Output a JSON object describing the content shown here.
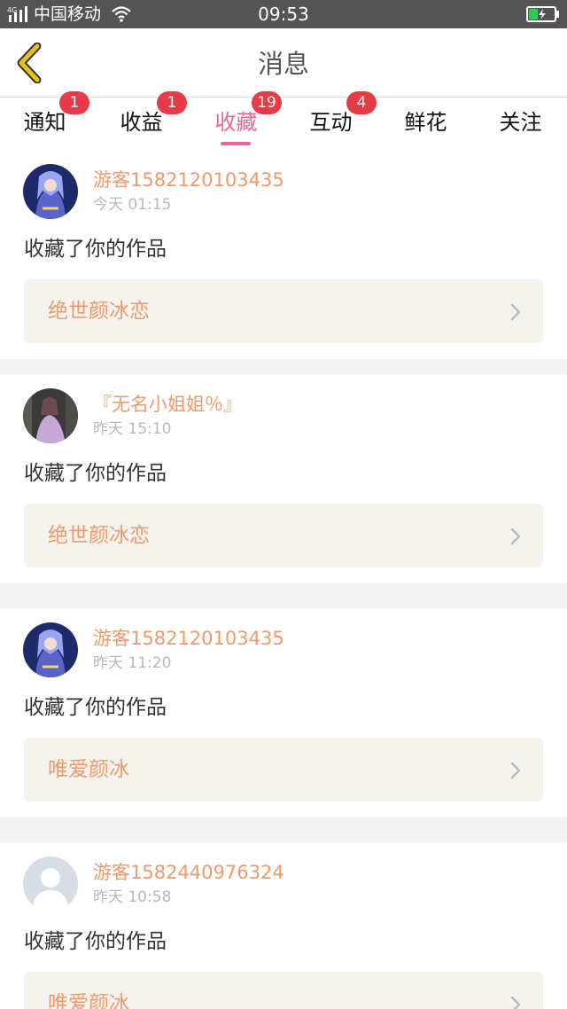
{
  "status_bar": {
    "network": "4G",
    "carrier": "中国移动",
    "time": "09:53",
    "icons": [
      "signal-icon",
      "wifi-icon",
      "battery-charging-icon"
    ],
    "battery_color": "#2ecc52"
  },
  "header": {
    "title": "消息",
    "back_icon": "chevron-left-icon",
    "back_icon_color": "#e8c21c"
  },
  "tabs": [
    {
      "label": "通知",
      "badge": "1"
    },
    {
      "label": "收益",
      "badge": "1"
    },
    {
      "label": "收藏",
      "badge": "19",
      "active": true
    },
    {
      "label": "互动",
      "badge": "4"
    },
    {
      "label": "鲜花",
      "badge": ""
    },
    {
      "label": "关注",
      "badge": ""
    }
  ],
  "colors": {
    "accent": "#e4679b",
    "username": "#ef9a6d",
    "badge": "#e73c48"
  },
  "notifications": [
    {
      "user": "游客1582120103435",
      "time": "今天 01:15",
      "action": "收藏了你的作品",
      "work": "绝世颜冰恋",
      "avatar": "anime-girl-blue"
    },
    {
      "user": "『无名小姐姐％』",
      "time": "昨天 15:10",
      "action": "收藏了你的作品",
      "work": "绝世颜冰恋",
      "avatar": "anime-girl-purple"
    },
    {
      "user": "游客1582120103435",
      "time": "昨天 11:20",
      "action": "收藏了你的作品",
      "work": "唯爱颜冰",
      "avatar": "anime-girl-blue"
    },
    {
      "user": "游客1582440976324",
      "time": "昨天 10:58",
      "action": "收藏了你的作品",
      "work": "唯爱颜冰",
      "avatar": "default-user-icon"
    }
  ]
}
